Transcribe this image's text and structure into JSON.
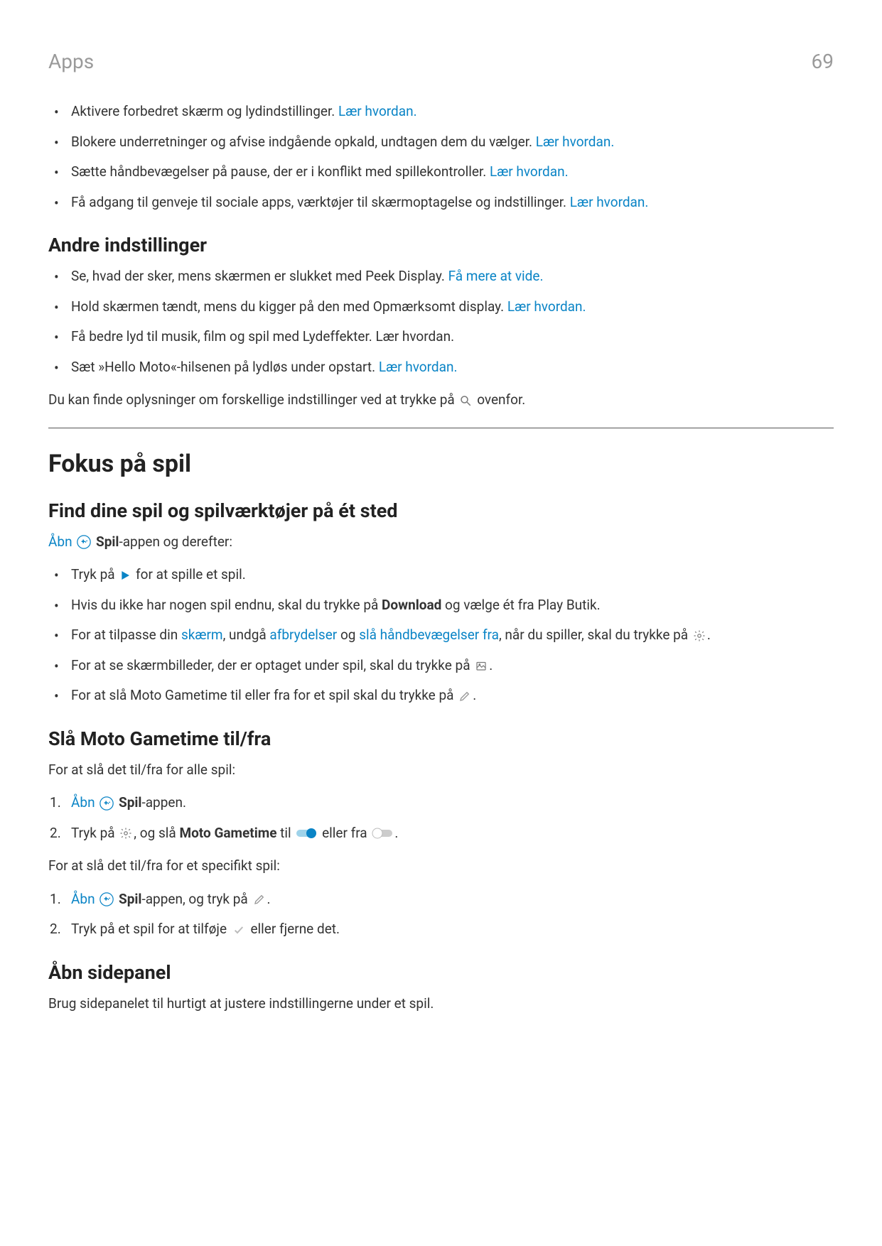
{
  "header": {
    "section": "Apps",
    "page": "69"
  },
  "topList": [
    {
      "text": "Aktivere forbedret skærm og lydindstillinger. ",
      "link": "Lær hvordan."
    },
    {
      "text": "Blokere underretninger og afvise indgående opkald, undtagen dem du vælger. ",
      "link": "Lær hvordan."
    },
    {
      "text": "Sætte håndbevægelser på pause, der er i konflikt med spillekontroller. ",
      "link": "Lær hvordan."
    },
    {
      "text": "Få adgang til genveje til sociale apps, værktøjer til skærmoptagelse og indstillinger. ",
      "link": "Lær hvordan."
    }
  ],
  "andre": {
    "heading": "Andre indstillinger",
    "items": [
      {
        "text": "Se, hvad der sker, mens skærmen er slukket med Peek Display. ",
        "link": "Få mere at vide."
      },
      {
        "text": "Hold skærmen tændt, mens du kigger på den med Opmærksomt display. ",
        "link": "Lær hvordan."
      },
      {
        "text": "Få bedre lyd til musik, film og spil med Lydeffekter. Lær hvordan.",
        "link": ""
      },
      {
        "text": "Sæt »Hello Moto«-hilsenen på lydløs under opstart. ",
        "link": "Lær hvordan."
      }
    ],
    "footer_pre": "Du kan finde oplysninger om forskellige indstillinger ved at trykke på ",
    "footer_post": " ovenfor."
  },
  "fokus": {
    "heading": "Fokus på spil",
    "find": {
      "heading": "Find dine spil og spilværktøjer på ét sted",
      "intro_open": "Åbn",
      "intro_spil": "Spil",
      "intro_post": "-appen og derefter:",
      "items": {
        "i1_pre": "Tryk på ",
        "i1_post": " for at spille et spil.",
        "i2_pre": "Hvis du ikke har nogen spil endnu, skal du trykke på ",
        "i2_bold": "Download",
        "i2_post": " og vælge ét fra Play Butik.",
        "i3_p1": "For at tilpasse din ",
        "i3_l1": "skærm",
        "i3_p2": ", undgå ",
        "i3_l2": "afbrydelser",
        "i3_p3": " og ",
        "i3_l3": "slå håndbevægelser fra",
        "i3_p4": ", når du spiller, skal du trykke på ",
        "i4_pre": "For at se skærmbilleder, der er optaget under spil, skal du trykke på ",
        "i5_pre": "For at slå Moto Gametime til eller fra for et spil skal du trykke på "
      }
    },
    "toggle": {
      "heading": "Slå Moto Gametime til/fra",
      "intro": "For at slå det til/fra for alle spil:",
      "step1_open": "Åbn",
      "step1_spil": "Spil",
      "step1_post": "-appen.",
      "step2_pre": "Tryk på ",
      "step2_mid": ", og slå ",
      "step2_bold": "Moto Gametime",
      "step2_til": " til ",
      "step2_eller": " eller fra ",
      "step2_end": ".",
      "intro2": "For at slå det til/fra for et specifikt spil:",
      "s2_1_open": "Åbn",
      "s2_1_spil": "Spil",
      "s2_1_mid": "-appen, og tryk på ",
      "s2_2_pre": "Tryk på et spil for at tilføje ",
      "s2_2_post": " eller fjerne det."
    },
    "side": {
      "heading": "Åbn sidepanel",
      "text": "Brug sidepanelet til hurtigt at justere indstillingerne under et spil."
    }
  }
}
